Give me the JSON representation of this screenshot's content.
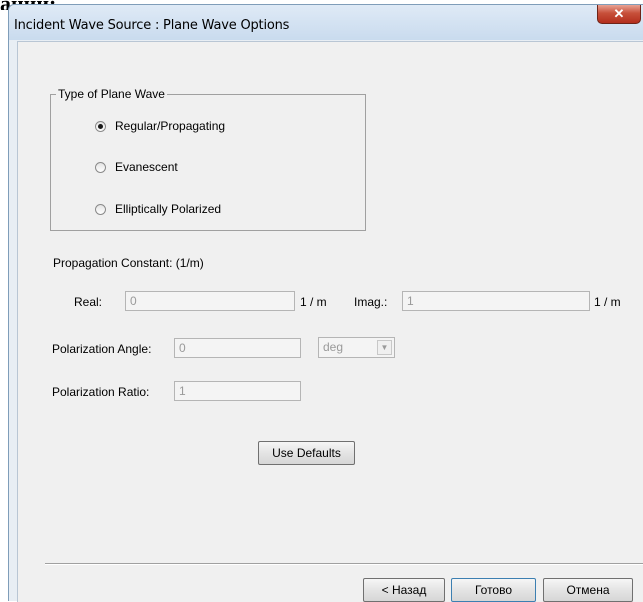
{
  "background_fragment": "ании:",
  "window": {
    "title": "Incident Wave Source : Plane Wave Options",
    "close_glyph": "✕"
  },
  "plane_wave_type": {
    "title": "Type of Plane Wave",
    "options": [
      {
        "label": "Regular/Propagating",
        "checked": true
      },
      {
        "label": "Evanescent",
        "checked": false
      },
      {
        "label": "Elliptically Polarized",
        "checked": false
      }
    ]
  },
  "propagation": {
    "heading": "Propagation Constant: (1/m)",
    "real_label": "Real:",
    "real_value": "0",
    "real_unit": "1 / m",
    "imag_label": "Imag.:",
    "imag_value": "1",
    "imag_unit": "1 / m"
  },
  "polarization": {
    "angle_label": "Polarization Angle:",
    "angle_value": "0",
    "angle_unit_selected": "deg",
    "ratio_label": "Polarization Ratio:",
    "ratio_value": "1"
  },
  "buttons": {
    "use_defaults": "Use Defaults",
    "back": "< Назад",
    "finish": "Готово",
    "cancel": "Отмена"
  },
  "colors": {
    "title_bar": "#c9dbee",
    "client": "#f0f0f0",
    "close_button": "#c7503a"
  }
}
